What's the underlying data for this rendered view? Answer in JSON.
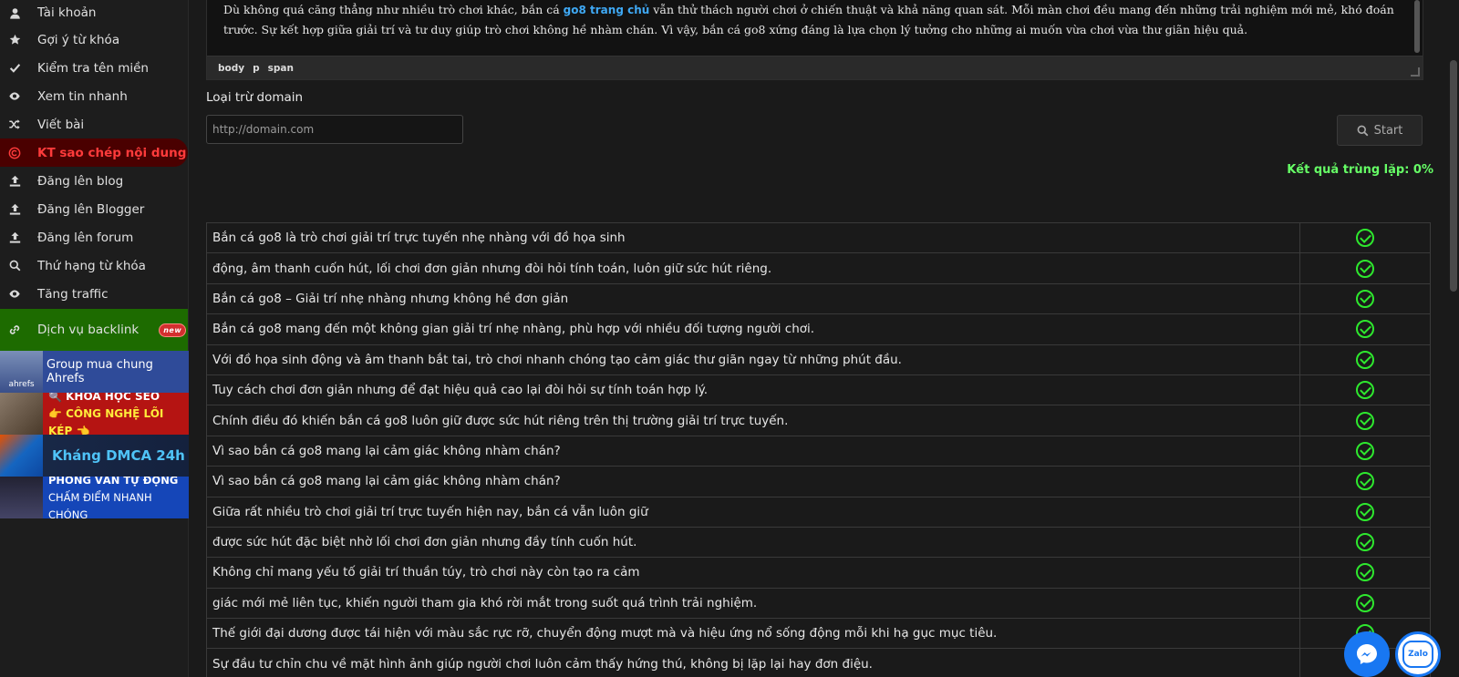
{
  "sidebar": {
    "items": [
      {
        "label": "Tài khoản",
        "icon": "user-icon"
      },
      {
        "label": "Gợi ý từ khóa",
        "icon": "star-icon"
      },
      {
        "label": "Kiểm tra tên miền",
        "icon": "check-icon"
      },
      {
        "label": "Xem tin nhanh",
        "icon": "eye-icon"
      },
      {
        "label": "Viết bài",
        "icon": "shuffle-icon"
      },
      {
        "label": "KT sao chép nội dung",
        "icon": "copyright-icon",
        "active": true
      },
      {
        "label": "Đăng lên blog",
        "icon": "upload-icon"
      },
      {
        "label": "Đăng lên Blogger",
        "icon": "upload-icon"
      },
      {
        "label": "Đăng lên forum",
        "icon": "upload-icon"
      },
      {
        "label": "Thứ hạng từ khóa",
        "icon": "search-icon"
      },
      {
        "label": "Tăng traffic",
        "icon": "eye-icon"
      }
    ],
    "backlink": {
      "label": "Dịch vụ backlink",
      "badge": "new",
      "icon": "link-icon"
    },
    "banners": {
      "ahrefs": {
        "brand": "ahrefs",
        "text": "Group mua chung Ahrefs"
      },
      "seo": {
        "line1": "🔍 KHÓA HỌC SEO",
        "line2": "👉 CÔNG NGHỆ LÕI KÉP 👈"
      },
      "dmca": {
        "text": "Kháng DMCA 24h"
      },
      "interview": {
        "line1": "PHỎNG VẤN TỰ ĐỘNG",
        "line2": "CHẤM ĐIỂM NHANH CHÓNG"
      }
    }
  },
  "editor": {
    "text_before": "Dù không quá căng thẳng như nhiều trò chơi khác, bắn cá ",
    "link_text": "go8 trang chủ",
    "text_after": " vẫn thử thách người chơi ở chiến thuật và khả năng quan sát. Mỗi màn chơi đều mang đến những trải nghiệm mới mẻ, khó đoán trước. Sự kết hợp giữa giải trí và tư duy giúp trò chơi không hề nhàm chán. Vì vậy, bắn cá go8 xứng đáng là lựa chọn lý tưởng cho những ai muốn vừa chơi vừa thư giãn hiệu quả.",
    "path": [
      "body",
      "p",
      "span"
    ]
  },
  "exclude": {
    "label": "Loại trừ domain",
    "placeholder": "http://domain.com",
    "value": ""
  },
  "start_button": {
    "label": "Start"
  },
  "result_text": "Kết quả trùng lặp: 0%",
  "colors": {
    "accent_green": "#66ff66",
    "check_green": "#2ee82e",
    "active_red": "#ff3b3b",
    "link_blue": "#3fa9f5"
  },
  "rows": [
    "Bắn cá go8 là trò chơi giải trí trực tuyến nhẹ nhàng với đồ họa sinh",
    "động, âm thanh cuốn hút, lối chơi đơn giản nhưng đòi hỏi tính toán, luôn giữ sức hút riêng.",
    "Bắn cá go8 – Giải trí nhẹ nhàng nhưng không hề đơn giản",
    "Bắn cá go8 mang đến một không gian giải trí nhẹ nhàng, phù hợp với nhiều đối tượng người chơi.",
    "Với đồ họa sinh động và âm thanh bắt tai, trò chơi nhanh chóng tạo cảm giác thư giãn ngay từ những phút đầu.",
    "Tuy cách chơi đơn giản nhưng để đạt hiệu quả cao lại đòi hỏi sự tính toán hợp lý.",
    "Chính điều đó khiến bắn cá go8 luôn giữ được sức hút riêng trên thị trường giải trí trực tuyến.",
    "Vì sao bắn cá go8 mang lại cảm giác không nhàm chán?",
    "Vì sao bắn cá go8 mang lại cảm giác không nhàm chán?",
    "Giữa rất nhiều trò chơi giải trí trực tuyến hiện nay, bắn cá vẫn luôn giữ",
    "được sức hút đặc biệt nhờ lối chơi đơn giản nhưng đầy tính cuốn hút.",
    "Không chỉ mang yếu tố giải trí thuần túy, trò chơi này còn tạo ra cảm",
    "giác mới mẻ liên tục, khiến người tham gia khó rời mắt trong suốt quá trình trải nghiệm.",
    "Thế giới đại dương được tái hiện với màu sắc rực rỡ, chuyển động mượt mà và hiệu ứng nổ sống động mỗi khi hạ gục mục tiêu.",
    "Sự đầu tư chỉn chu về mặt hình ảnh giúp người chơi luôn cảm thấy hứng thú, không bị lặp lại hay đơn điệu."
  ],
  "fab": {
    "zalo_label": "Zalo"
  }
}
